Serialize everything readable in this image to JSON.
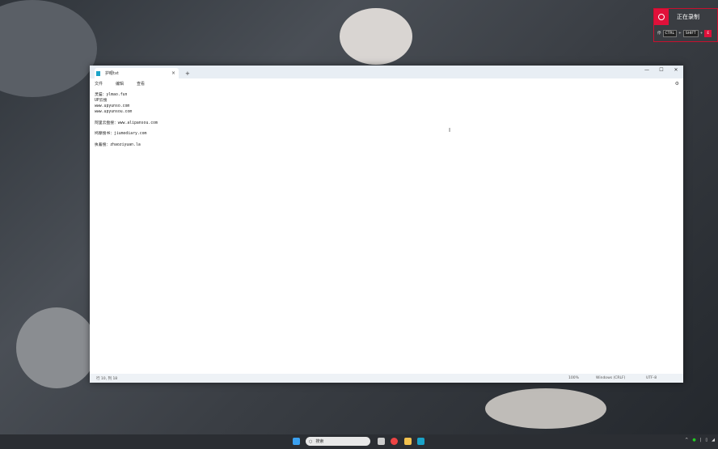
{
  "recording": {
    "status": "正在录制",
    "keys": [
      "CTRL",
      "SHIFT",
      "E"
    ],
    "key_prefix": "停"
  },
  "window": {
    "tab_title": "护眼txt",
    "tab_close": "×",
    "new_tab": "+",
    "controls": [
      "—",
      "☐",
      "✕"
    ],
    "menu": [
      "文件",
      "编辑",
      "查看"
    ],
    "settings_icon": "gear-icon"
  },
  "editor": {
    "lines": [
      "灵猫：ylmao.fun",
      "UP云搜",
      "www.upyunso.com",
      "www.upyunsou.com",
      "",
      "阿里云盘搜：www.alipansou.com",
      "",
      "鸠摩搜书：jiumodiary.com",
      "",
      "执着搜：zhaoziyuan.la"
    ]
  },
  "status": {
    "position": "行 10, 列 18",
    "zoom": "100%",
    "line_ending": "Windows (CRLF)",
    "encoding": "UTF-8"
  },
  "taskbar": {
    "search_placeholder": "搜索"
  }
}
